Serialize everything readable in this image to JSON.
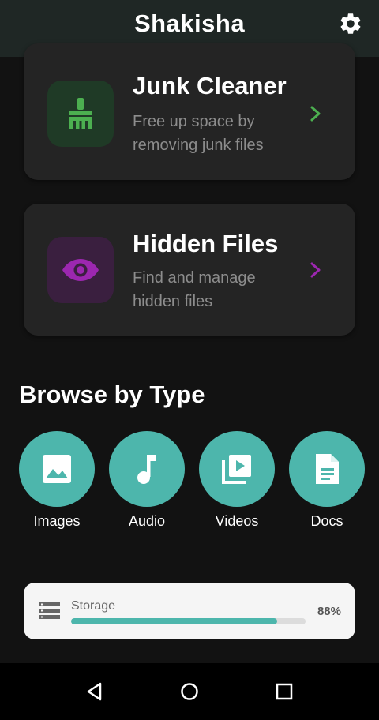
{
  "app_bar": {
    "title": "Shakisha",
    "settings_icon": "gear-icon"
  },
  "cards": {
    "junk": {
      "title": "Junk Cleaner",
      "description": "Free up space by removing junk files",
      "icon": "broom-icon",
      "accent": "#4caf50"
    },
    "hidden": {
      "title": "Hidden Files",
      "description": "Find and manage hidden files",
      "icon": "eye-icon",
      "accent": "#9c27b0"
    }
  },
  "browse": {
    "title": "Browse by Type",
    "accent": "#4db6ac",
    "types": [
      {
        "label": "Images",
        "icon": "image-icon"
      },
      {
        "label": "Audio",
        "icon": "music-note-icon"
      },
      {
        "label": "Videos",
        "icon": "video-library-icon"
      },
      {
        "label": "Docs",
        "icon": "document-icon"
      }
    ]
  },
  "storage": {
    "label": "Storage",
    "percent_text": "88%",
    "used_fraction": 0.88,
    "icon": "storage-icon"
  },
  "nav": {
    "back": "back-icon",
    "home": "home-icon",
    "recents": "recents-icon"
  }
}
